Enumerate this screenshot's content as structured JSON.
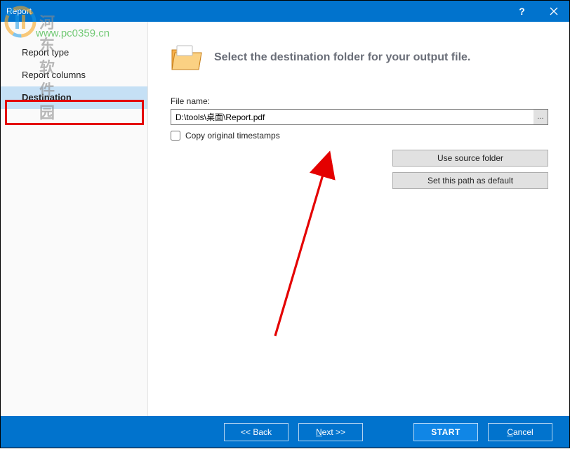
{
  "window": {
    "title": "Report"
  },
  "sidebar": {
    "items": [
      {
        "label": "Report type"
      },
      {
        "label": "Report columns"
      },
      {
        "label": "Destination"
      }
    ]
  },
  "main": {
    "heading": "Select the destination folder for your output file.",
    "file_label": "File name:",
    "file_value": "D:\\tools\\桌面\\Report.pdf",
    "browse_label": "...",
    "checkbox_label": "Copy original timestamps",
    "use_source_btn": "Use source folder",
    "set_default_btn": "Set this path as default"
  },
  "footer": {
    "back": "<<  Back",
    "next_prefix": "N",
    "next_rest": "ext  >>",
    "start": "START",
    "cancel_prefix": "C",
    "cancel_rest": "ancel"
  },
  "watermark": {
    "text1": "河东软件园",
    "text2": "www.pc0359.cn"
  }
}
